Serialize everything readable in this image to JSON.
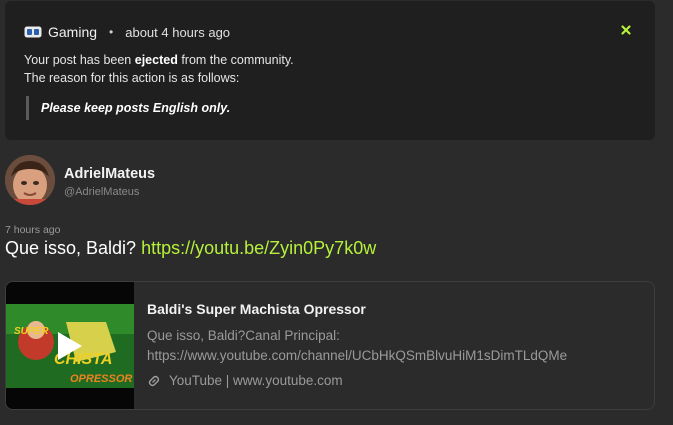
{
  "notice": {
    "community": "Gaming",
    "separator": "•",
    "time": "about 4 hours ago",
    "line1_pre": "Your post has been ",
    "line1_bold": "ejected",
    "line1_post": " from the community.",
    "line2": "The reason for this action is as follows:",
    "reason": "Please keep posts English only.",
    "close_icon": "close-icon",
    "accent": "#b6f23a"
  },
  "post": {
    "author": "AdrielMateus",
    "handle": "@AdrielMateus",
    "time": "7 hours ago",
    "text": "Que isso, Baldi? ",
    "link": "https://youtu.be/Zyin0Py7k0w",
    "link_color": "#b6f23a"
  },
  "embed": {
    "title": "Baldi's Super Machista Opressor",
    "desc_line1": "Que isso, Baldi?Canal Principal:",
    "desc_line2": "https://www.youtube.com/channel/UCbHkQSmBlvuHiM1sDimTLdQMe",
    "source": "YouTube | www.youtube.com",
    "source_icon": "link-icon",
    "thumb_icon": "play-icon"
  }
}
